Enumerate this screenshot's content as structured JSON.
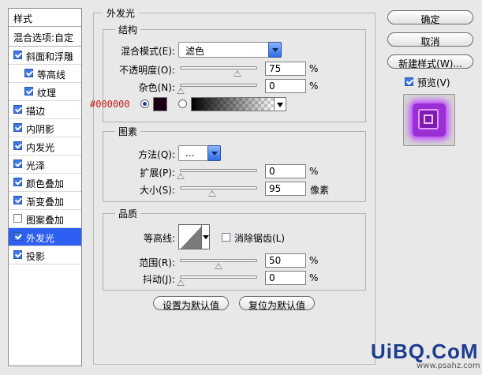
{
  "left_panel": {
    "header": "样式",
    "blend_options": "混合选项:自定",
    "items": [
      {
        "label": "斜面和浮雕",
        "checked": true
      },
      {
        "label": "等高线",
        "checked": true
      },
      {
        "label": "纹理",
        "checked": true
      },
      {
        "label": "描边",
        "checked": true
      },
      {
        "label": "内阴影",
        "checked": true
      },
      {
        "label": "内发光",
        "checked": true
      },
      {
        "label": "光泽",
        "checked": true
      },
      {
        "label": "颜色叠加",
        "checked": true
      },
      {
        "label": "渐变叠加",
        "checked": true
      },
      {
        "label": "图案叠加",
        "checked": false
      },
      {
        "label": "外发光",
        "checked": true,
        "selected": true
      },
      {
        "label": "投影",
        "checked": true
      }
    ]
  },
  "panel": {
    "title": "外发光",
    "structure": {
      "title": "结构",
      "blend_mode_label": "混合模式(E):",
      "blend_mode_value": "滤色",
      "opacity_label": "不透明度(O):",
      "opacity_value": "75",
      "noise_label": "杂色(N):",
      "noise_value": "0",
      "percent": "%",
      "color_hex": "#000000",
      "swatch_color": "#1a0010"
    },
    "elements": {
      "title": "图素",
      "method_label": "方法(Q):",
      "method_value": "...",
      "spread_label": "扩展(P):",
      "spread_value": "0",
      "size_label": "大小(S):",
      "size_value": "95",
      "percent": "%",
      "pixels": "像素"
    },
    "quality": {
      "title": "品质",
      "contour_label": "等高线:",
      "antialias_label": "消除锯齿(L)",
      "range_label": "范围(R):",
      "range_value": "50",
      "jitter_label": "抖动(J):",
      "jitter_value": "0",
      "percent": "%"
    },
    "set_default": "设置为默认值",
    "reset_default": "复位为默认值"
  },
  "right_panel": {
    "ok": "确定",
    "cancel": "取消",
    "new_style": "新建样式(W)...",
    "preview_label": "预览(V)",
    "preview_checked": true
  },
  "watermark": {
    "logo": "UiBQ.CoM",
    "url": "www.psahz.com"
  },
  "colors": {
    "selection": "#2d5ff2",
    "preview_purple": "#9b2fd6"
  }
}
